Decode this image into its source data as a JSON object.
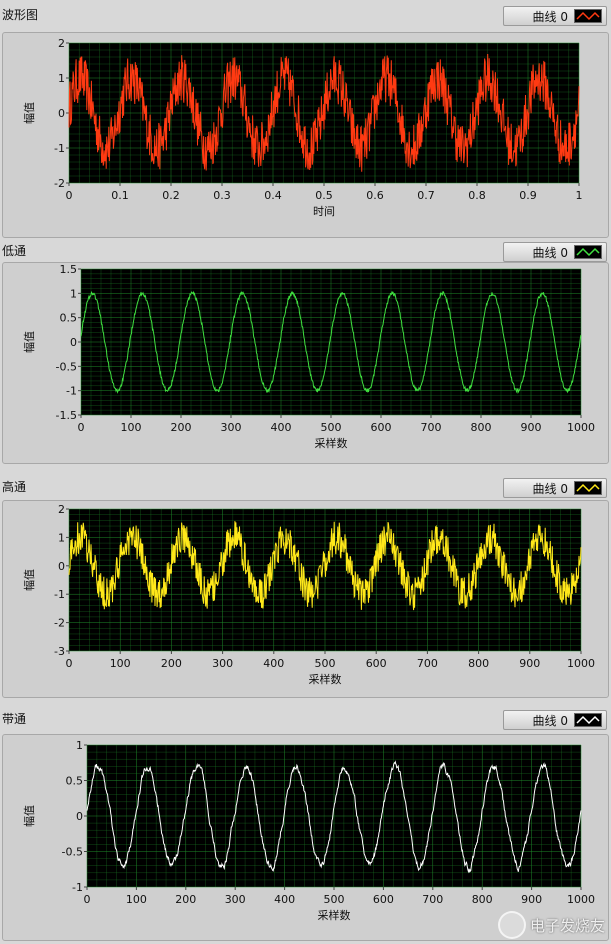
{
  "panels": [
    {
      "title": "波形图",
      "legend": "曲线 0",
      "color": "#ff3a12",
      "xlabel": "时间",
      "ylabel": "幅值"
    },
    {
      "title": "低通",
      "legend": "曲线 0",
      "color": "#40e040",
      "xlabel": "采样数",
      "ylabel": "幅值"
    },
    {
      "title": "高通",
      "legend": "曲线 0",
      "color": "#ffe81a",
      "xlabel": "采样数",
      "ylabel": "幅值"
    },
    {
      "title": "带通",
      "legend": "曲线 0",
      "color": "#ffffff",
      "xlabel": "采样数",
      "ylabel": "幅值"
    }
  ],
  "watermark": "电子发烧友",
  "chart_data": [
    {
      "type": "line",
      "title": "波形图",
      "xlabel": "时间",
      "ylabel": "幅值",
      "xlim": [
        0,
        1
      ],
      "ylim": [
        -2,
        2
      ],
      "xticks": [
        "0",
        "0.1",
        "0.2",
        "0.3",
        "0.4",
        "0.5",
        "0.6",
        "0.7",
        "0.8",
        "0.9",
        "1"
      ],
      "yticks": [
        "2",
        "1",
        "0",
        "-1",
        "-2"
      ],
      "grid": true,
      "legend": "top-right",
      "series": [
        {
          "name": "曲线 0",
          "description": "sine ~10 cycles, amplitude ~1, heavy high-frequency noise",
          "cycles": 10,
          "amplitude": 1.0,
          "noise": 0.7
        }
      ]
    },
    {
      "type": "line",
      "title": "低通",
      "xlabel": "采样数",
      "ylabel": "幅值",
      "xlim": [
        0,
        1000
      ],
      "ylim": [
        -1.5,
        1.5
      ],
      "xticks": [
        "0",
        "100",
        "200",
        "300",
        "400",
        "500",
        "600",
        "700",
        "800",
        "900",
        "1000"
      ],
      "yticks": [
        "1.5",
        "1",
        "0.5",
        "0",
        "-0.5",
        "-1",
        "-1.5"
      ],
      "grid": true,
      "legend": "top-right",
      "series": [
        {
          "name": "曲线 0",
          "description": "smooth sine ~10 cycles, amplitude ~1",
          "cycles": 10,
          "amplitude": 1.0,
          "noise": 0.04
        }
      ]
    },
    {
      "type": "line",
      "title": "高通",
      "xlabel": "采样数",
      "ylabel": "幅值",
      "xlim": [
        0,
        1000
      ],
      "ylim": [
        -3,
        2
      ],
      "xticks": [
        "0",
        "100",
        "200",
        "300",
        "400",
        "500",
        "600",
        "700",
        "800",
        "900",
        "1000"
      ],
      "yticks": [
        "2",
        "1",
        "0",
        "-1",
        "-2",
        "-3"
      ],
      "grid": true,
      "legend": "top-right",
      "series": [
        {
          "name": "曲线 0",
          "description": "sine ~10 cycles, amplitude ~1, with high-frequency noise",
          "cycles": 10,
          "amplitude": 1.0,
          "noise": 0.6
        }
      ]
    },
    {
      "type": "line",
      "title": "带通",
      "xlabel": "采样数",
      "ylabel": "幅值",
      "xlim": [
        0,
        1000
      ],
      "ylim": [
        -1,
        1
      ],
      "xticks": [
        "0",
        "100",
        "200",
        "300",
        "400",
        "500",
        "600",
        "700",
        "800",
        "900",
        "1000"
      ],
      "yticks": [
        "1",
        "0.5",
        "0",
        "-0.5",
        "-1"
      ],
      "grid": true,
      "legend": "top-right",
      "series": [
        {
          "name": "曲线 0",
          "description": "band-passed sine ~10 cycles, amplitude ~0.7",
          "cycles": 10,
          "amplitude": 0.7,
          "noise": 0.1
        }
      ]
    }
  ]
}
